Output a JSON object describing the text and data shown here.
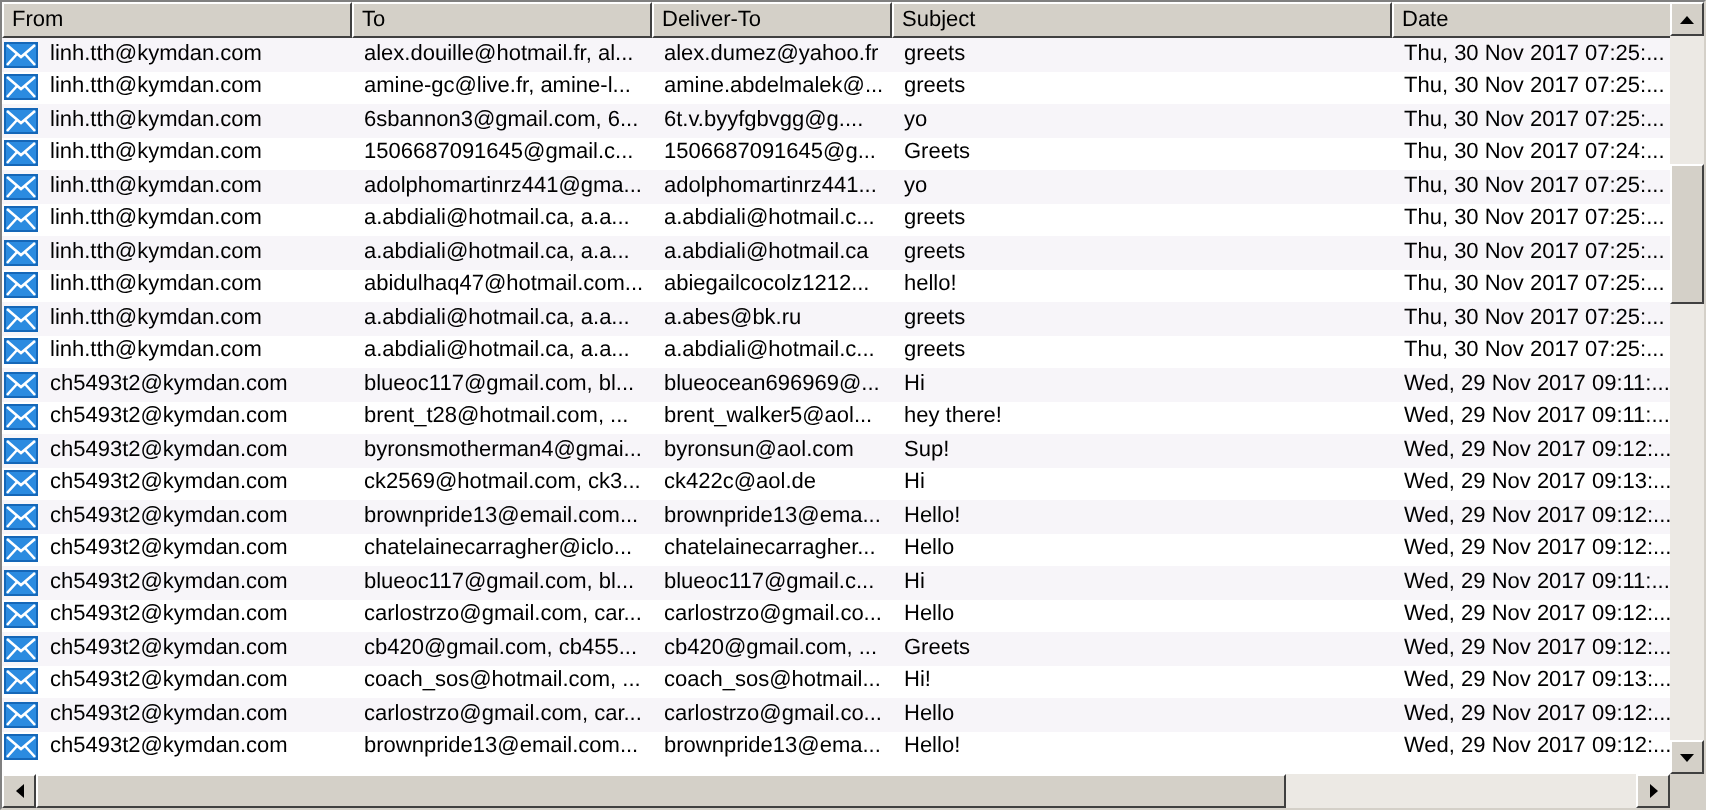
{
  "table": {
    "columns": [
      "From",
      "To",
      "Deliver-To",
      "Subject",
      "Date"
    ],
    "rows": [
      [
        "linh.tth@kymdan.com",
        "alex.douille@hotmail.fr, al...",
        "alex.dumez@yahoo.fr",
        "greets",
        "Thu, 30 Nov 2017 07:25:..."
      ],
      [
        "linh.tth@kymdan.com",
        "amine-gc@live.fr, amine-l...",
        "amine.abdelmalek@...",
        "greets",
        "Thu, 30 Nov 2017 07:25:..."
      ],
      [
        "linh.tth@kymdan.com",
        "6sbannon3@gmail.com, 6...",
        "6t.v.byyfgbvgg@g....",
        "yo",
        "Thu, 30 Nov 2017 07:25:..."
      ],
      [
        "linh.tth@kymdan.com",
        "1506687091645@gmail.c...",
        "1506687091645@g...",
        "Greets",
        "Thu, 30 Nov 2017 07:24:..."
      ],
      [
        "linh.tth@kymdan.com",
        "adolphomartinrz441@gma...",
        "adolphomartinrz441...",
        "yo",
        "Thu, 30 Nov 2017 07:25:..."
      ],
      [
        "linh.tth@kymdan.com",
        "a.abdiali@hotmail.ca, a.a...",
        "a.abdiali@hotmail.c...",
        "greets",
        "Thu, 30 Nov 2017 07:25:..."
      ],
      [
        "linh.tth@kymdan.com",
        "a.abdiali@hotmail.ca, a.a...",
        "a.abdiali@hotmail.ca",
        "greets",
        "Thu, 30 Nov 2017 07:25:..."
      ],
      [
        "linh.tth@kymdan.com",
        "abidulhaq47@hotmail.com...",
        "abiegailcocolz1212...",
        "hello!",
        "Thu, 30 Nov 2017 07:25:..."
      ],
      [
        "linh.tth@kymdan.com",
        "a.abdiali@hotmail.ca, a.a...",
        "a.abes@bk.ru",
        "greets",
        "Thu, 30 Nov 2017 07:25:..."
      ],
      [
        "linh.tth@kymdan.com",
        "a.abdiali@hotmail.ca, a.a...",
        "a.abdiali@hotmail.c...",
        "greets",
        "Thu, 30 Nov 2017 07:25:..."
      ],
      [
        "ch5493t2@kymdan.com",
        "blueoc117@gmail.com, bl...",
        "blueocean696969@...",
        "Hi",
        "Wed, 29 Nov 2017 09:11:..."
      ],
      [
        "ch5493t2@kymdan.com",
        "brent_t28@hotmail.com, ...",
        "brent_walker5@aol...",
        "hey there!",
        "Wed, 29 Nov 2017 09:11:..."
      ],
      [
        "ch5493t2@kymdan.com",
        "byronsmotherman4@gmai...",
        "byronsun@aol.com",
        "Sup!",
        "Wed, 29 Nov 2017 09:12:..."
      ],
      [
        "ch5493t2@kymdan.com",
        "ck2569@hotmail.com, ck3...",
        "ck422c@aol.de",
        "Hi",
        "Wed, 29 Nov 2017 09:13:..."
      ],
      [
        "ch5493t2@kymdan.com",
        "brownpride13@email.com...",
        "brownpride13@ema...",
        "Hello!",
        "Wed, 29 Nov 2017 09:12:..."
      ],
      [
        "ch5493t2@kymdan.com",
        "chatelainecarragher@iclo...",
        "chatelainecarragher...",
        "Hello",
        "Wed, 29 Nov 2017 09:12:..."
      ],
      [
        "ch5493t2@kymdan.com",
        "blueoc117@gmail.com, bl...",
        "blueoc117@gmail.c...",
        "Hi",
        "Wed, 29 Nov 2017 09:11:..."
      ],
      [
        "ch5493t2@kymdan.com",
        "carlostrzo@gmail.com, car...",
        "carlostrzo@gmail.co...",
        "Hello",
        "Wed, 29 Nov 2017 09:12:..."
      ],
      [
        "ch5493t2@kymdan.com",
        "cb420@gmail.com, cb455...",
        "cb420@gmail.com, ...",
        "Greets",
        "Wed, 29 Nov 2017 09:12:..."
      ],
      [
        "ch5493t2@kymdan.com",
        "coach_sos@hotmail.com, ...",
        "coach_sos@hotmail...",
        "Hi!",
        "Wed, 29 Nov 2017 09:13:..."
      ],
      [
        "ch5493t2@kymdan.com",
        "carlostrzo@gmail.com, car...",
        "carlostrzo@gmail.co...",
        "Hello",
        "Wed, 29 Nov 2017 09:12:..."
      ],
      [
        "ch5493t2@kymdan.com",
        "brownpride13@email.com...",
        "brownpride13@ema...",
        "Hello!",
        "Wed, 29 Nov 2017 09:12:..."
      ]
    ]
  }
}
